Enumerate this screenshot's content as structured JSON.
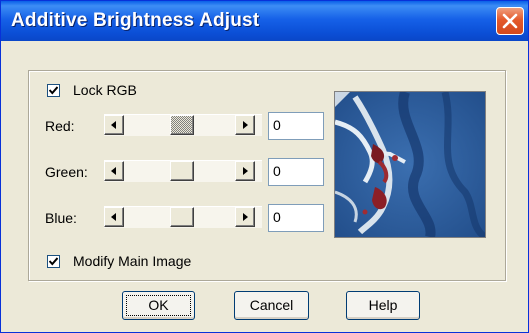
{
  "window": {
    "title": "Additive Brightness Adjust"
  },
  "lock_rgb": {
    "label": "Lock RGB",
    "checked": true
  },
  "sliders": [
    {
      "label": "Red:",
      "value": "0",
      "thumb_focused": true
    },
    {
      "label": "Green:",
      "value": "0",
      "thumb_focused": false
    },
    {
      "label": "Blue:",
      "value": "0",
      "thumb_focused": false
    }
  ],
  "modify_main_image": {
    "label": "Modify Main Image",
    "checked": true
  },
  "buttons": {
    "ok": "OK",
    "cancel": "Cancel",
    "help": "Help"
  },
  "icons": {
    "close": "close-icon",
    "check": "checkmark-icon",
    "left": "arrow-left-icon",
    "right": "arrow-right-icon"
  },
  "colors": {
    "titlebar": "#0b4fd6",
    "close": "#e45a2c",
    "face": "#ece9d8"
  }
}
